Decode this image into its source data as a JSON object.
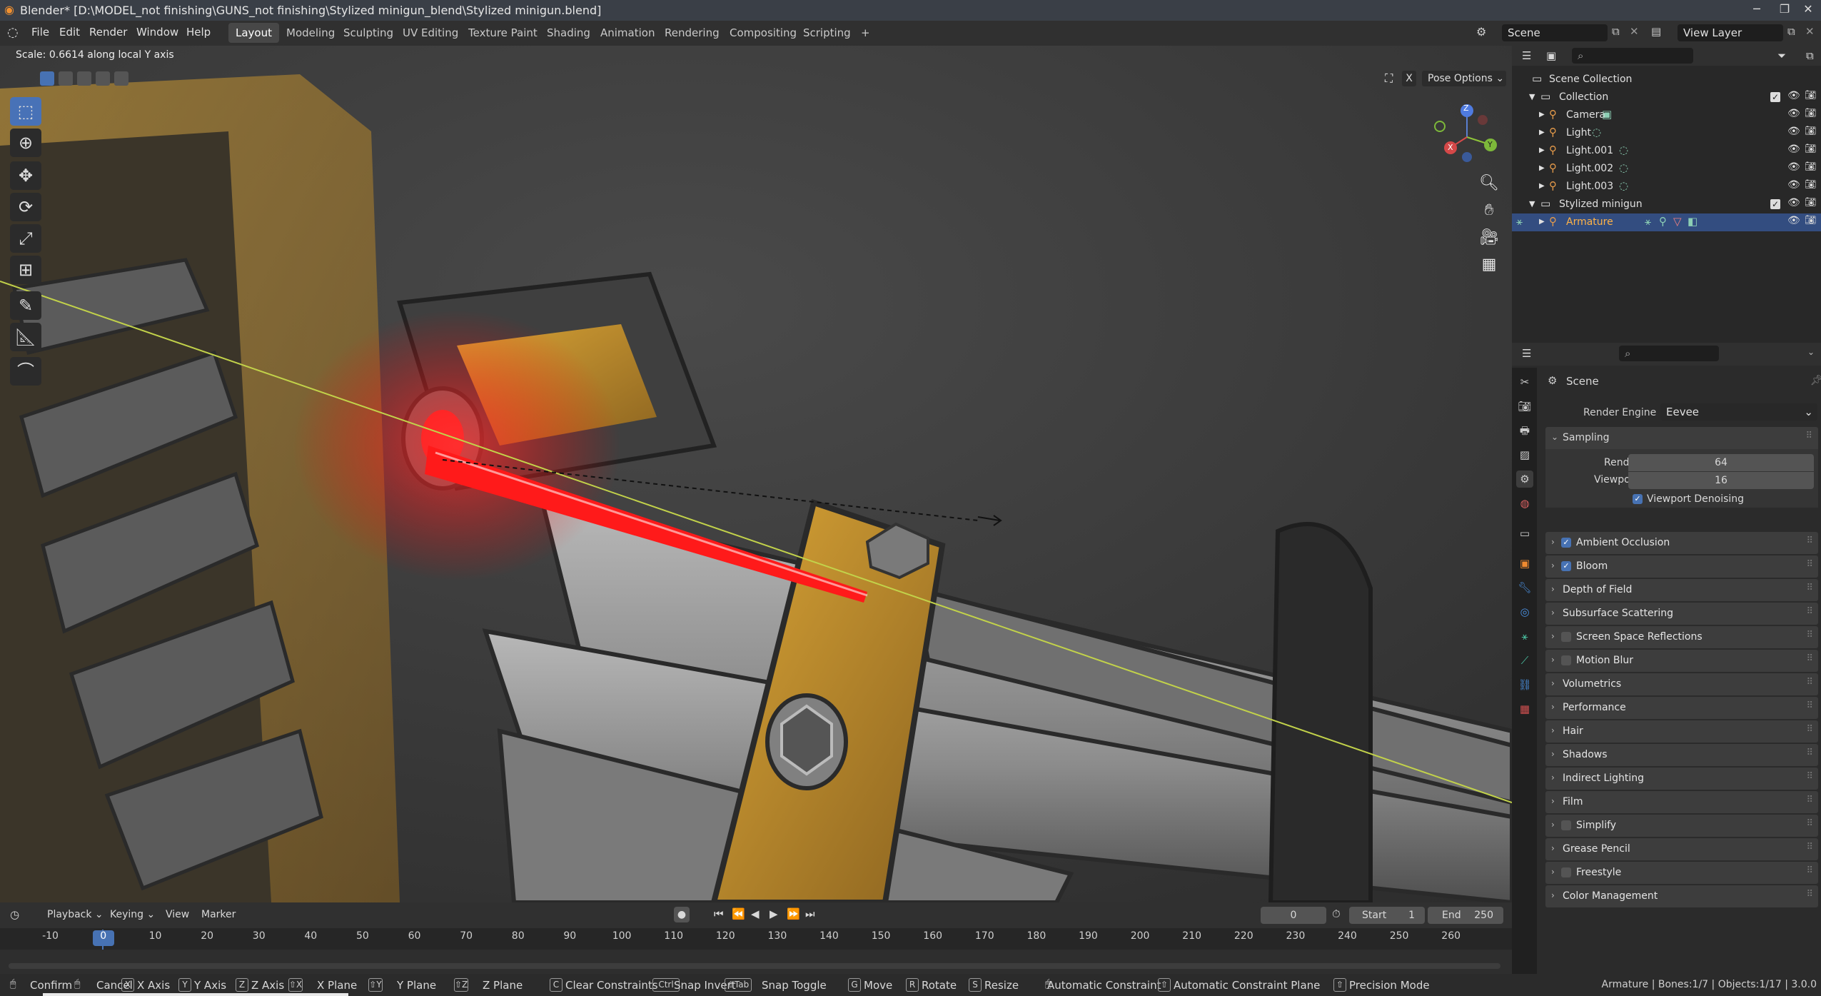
{
  "title_bar": {
    "title": "Blender* [D:\\MODEL_not finishing\\GUNS_not finishing\\Stylized minigun_blend\\Stylized minigun.blend]",
    "minimize": "─",
    "maximize": "❐",
    "close": "✕"
  },
  "menu": [
    "File",
    "Edit",
    "Render",
    "Window",
    "Help"
  ],
  "workspaces": [
    "Layout",
    "Modeling",
    "Sculpting",
    "UV Editing",
    "Texture Paint",
    "Shading",
    "Animation",
    "Rendering",
    "Compositing",
    "Scripting"
  ],
  "workspace_add": "+",
  "active_workspace": "Layout",
  "scene_selector": "Scene",
  "view_layer_selector": "View Layer",
  "viewport": {
    "operator_status": "Scale: 0.6614 along local Y axis",
    "pose_options": "Pose Options",
    "gizmo_axes": {
      "x": "X",
      "y": "Y",
      "z": "Z"
    },
    "close_x": "X",
    "tools": [
      "select-box-icon",
      "cursor-icon",
      "move-icon",
      "rotate-icon",
      "scale-icon",
      "transform-icon",
      "annotate-icon",
      "measure-icon",
      "bone-envelope-icon"
    ]
  },
  "outliner": {
    "rows": [
      {
        "label": "Scene Collection",
        "indent": 0,
        "type": "scene"
      },
      {
        "label": "Collection",
        "indent": 1,
        "type": "collection"
      },
      {
        "label": "Camera",
        "indent": 2,
        "type": "object"
      },
      {
        "label": "Light",
        "indent": 2,
        "type": "object"
      },
      {
        "label": "Light.001",
        "indent": 2,
        "type": "object"
      },
      {
        "label": "Light.002",
        "indent": 2,
        "type": "object"
      },
      {
        "label": "Light.003",
        "indent": 2,
        "type": "object"
      },
      {
        "label": "Stylized minigun",
        "indent": 1,
        "type": "collection"
      },
      {
        "label": "Armature",
        "indent": 2,
        "type": "object",
        "selected": true
      }
    ]
  },
  "properties": {
    "context": "Scene",
    "render_engine_label": "Render Engine",
    "render_engine": "Eevee",
    "sampling_label": "Sampling",
    "render_label": "Render",
    "render_value": "64",
    "viewport_label": "Viewport",
    "viewport_value": "16",
    "viewport_denoising": "Viewport Denoising",
    "panels": [
      {
        "label": "Ambient Occlusion",
        "checkbox": true,
        "checked": true
      },
      {
        "label": "Bloom",
        "checkbox": true,
        "checked": true
      },
      {
        "label": "Depth of Field",
        "checkbox": false
      },
      {
        "label": "Subsurface Scattering",
        "checkbox": false
      },
      {
        "label": "Screen Space Reflections",
        "checkbox": true,
        "checked": false
      },
      {
        "label": "Motion Blur",
        "checkbox": true,
        "checked": false
      },
      {
        "label": "Volumetrics",
        "checkbox": false
      },
      {
        "label": "Performance",
        "checkbox": false
      },
      {
        "label": "Hair",
        "checkbox": false
      },
      {
        "label": "Shadows",
        "checkbox": false
      },
      {
        "label": "Indirect Lighting",
        "checkbox": false
      },
      {
        "label": "Film",
        "checkbox": false
      },
      {
        "label": "Simplify",
        "checkbox": true,
        "checked": false
      },
      {
        "label": "Grease Pencil",
        "checkbox": false
      },
      {
        "label": "Freestyle",
        "checkbox": true,
        "checked": false
      },
      {
        "label": "Color Management",
        "checkbox": false
      }
    ]
  },
  "timeline": {
    "menus": [
      "Playback",
      "Keying",
      "View",
      "Marker"
    ],
    "current_frame": "0",
    "start_label": "Start",
    "start_value": "1",
    "end_label": "End",
    "end_value": "250",
    "ruler": [
      "-10",
      "0",
      "10",
      "20",
      "30",
      "40",
      "50",
      "60",
      "70",
      "80",
      "90",
      "100",
      "110",
      "120",
      "130",
      "140",
      "150",
      "160",
      "170",
      "180",
      "190",
      "200",
      "210",
      "220",
      "230",
      "240",
      "250",
      "260"
    ]
  },
  "statusbar": {
    "items": [
      {
        "key": "",
        "label": "Confirm"
      },
      {
        "key": "",
        "label": "Cancel"
      },
      {
        "key": "X",
        "label": "X Axis"
      },
      {
        "key": "Y",
        "label": "Y Axis"
      },
      {
        "key": "Z",
        "label": "Z Axis"
      },
      {
        "key": "⇧X",
        "label": "X Plane"
      },
      {
        "key": "⇧Y",
        "label": "Y Plane"
      },
      {
        "key": "⇧Z",
        "label": "Z Plane"
      },
      {
        "key": "C",
        "label": "Clear Constraints"
      },
      {
        "key": "Ctrl",
        "label": "Snap Invert"
      },
      {
        "key": "⇧Tab",
        "label": "Snap Toggle"
      },
      {
        "key": "G",
        "label": "Move"
      },
      {
        "key": "R",
        "label": "Rotate"
      },
      {
        "key": "S",
        "label": "Resize"
      },
      {
        "key": "",
        "label": "Automatic Constraint"
      },
      {
        "key": "⇧",
        "label": "Automatic Constraint Plane"
      },
      {
        "key": "⇧",
        "label": "Precision Mode"
      }
    ],
    "info": "Armature | Bones:1/7 | Objects:1/17 | 3.0.0"
  },
  "colors": {
    "accent": "#4772b3",
    "laser": "#ff1a1a",
    "gun_yellow": "#c8962a",
    "barrel": "#8a8a8a"
  }
}
